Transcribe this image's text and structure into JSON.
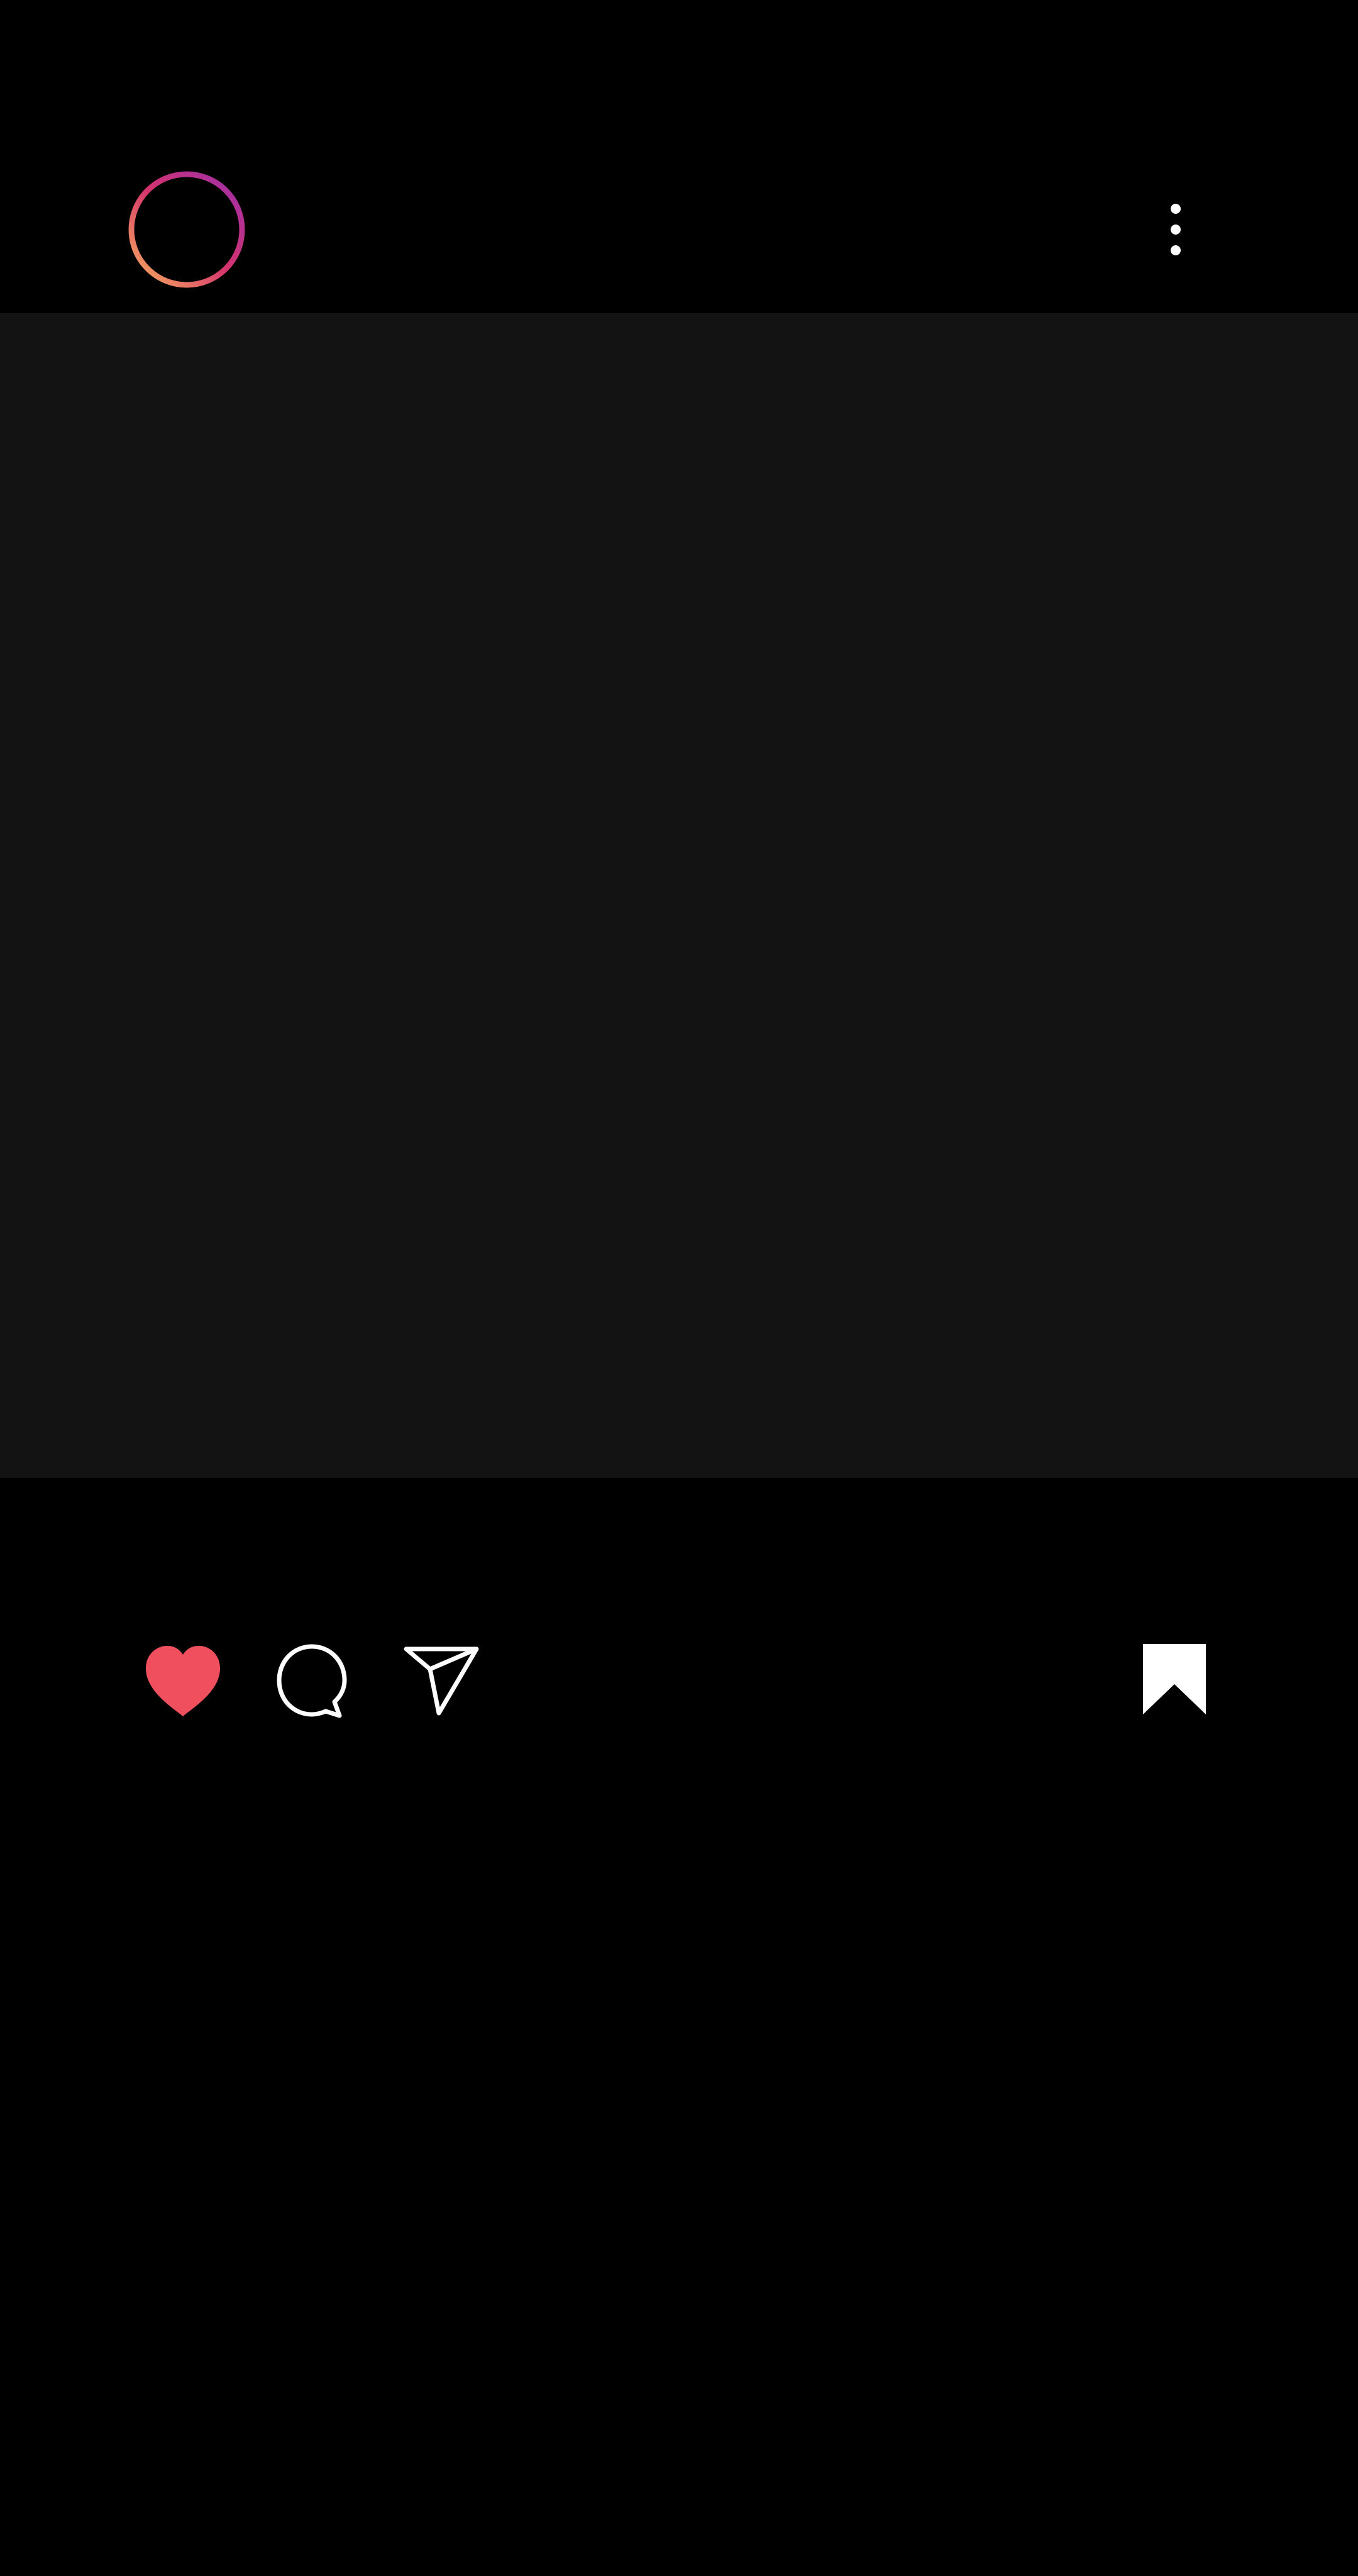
{
  "post": {
    "avatar": {
      "ring_gradient": [
        "#f2a65a",
        "#d6336c",
        "#9b2fae"
      ]
    },
    "header": {
      "more_icon": "more-vertical-icon",
      "more_icon_color": "#ffffff"
    },
    "media": {
      "background": "#131313"
    },
    "actions": {
      "like": {
        "icon": "heart-icon",
        "state": "liked",
        "color": "#f0505e"
      },
      "comment": {
        "icon": "comment-icon",
        "color": "#ffffff"
      },
      "share": {
        "icon": "paper-plane-icon",
        "color": "#ffffff"
      },
      "save": {
        "icon": "bookmark-icon",
        "state": "saved",
        "color": "#ffffff"
      }
    }
  }
}
